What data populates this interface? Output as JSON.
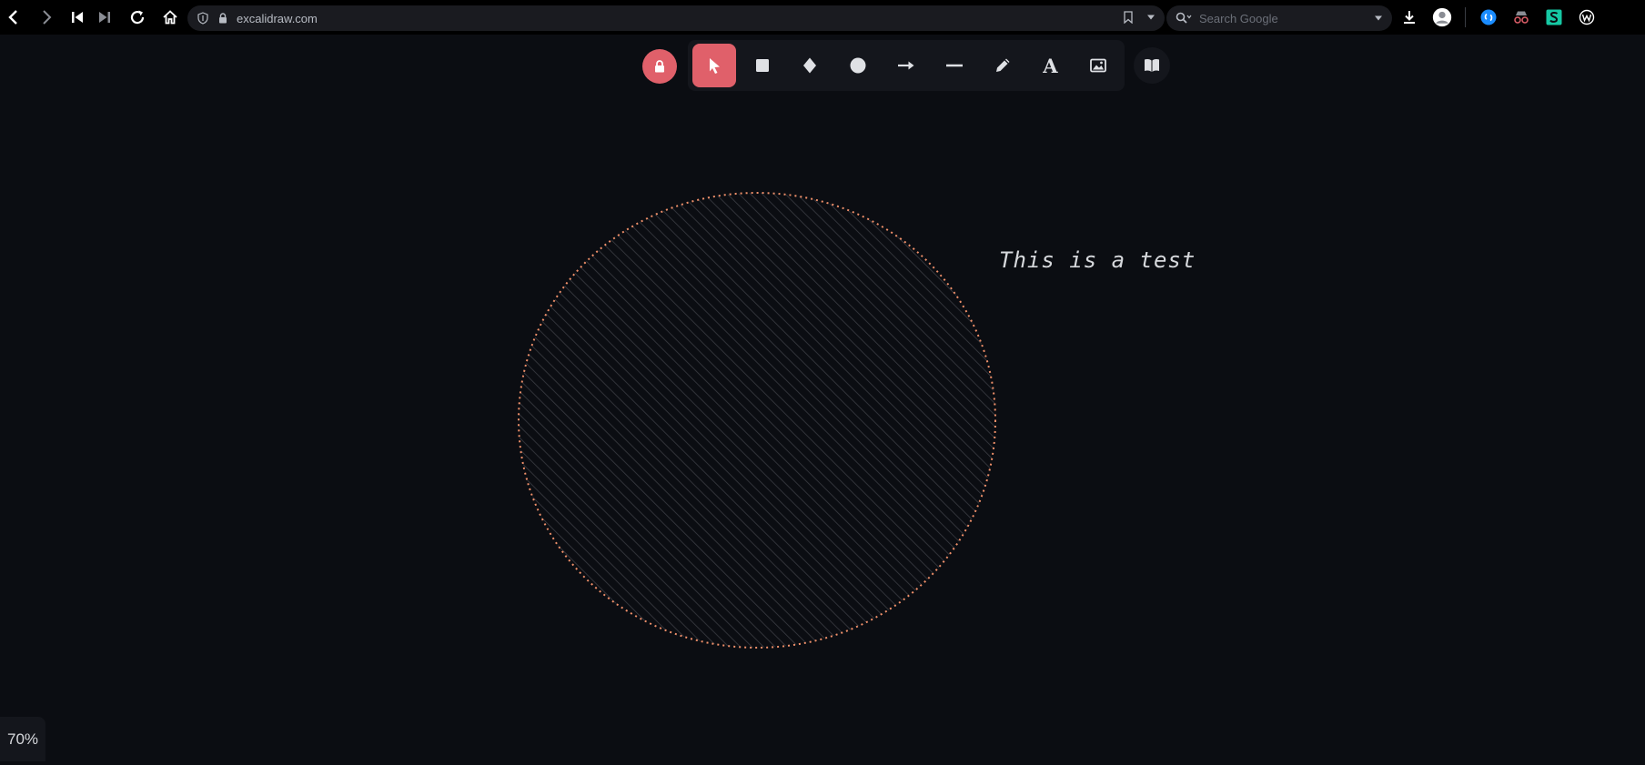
{
  "browser": {
    "url": "excalidraw.com",
    "search_placeholder": "Search Google"
  },
  "toolbar": {
    "tools": [
      {
        "name": "selection",
        "icon": "cursor-icon",
        "active": true
      },
      {
        "name": "rectangle",
        "icon": "square-icon"
      },
      {
        "name": "diamond",
        "icon": "diamond-icon"
      },
      {
        "name": "ellipse",
        "icon": "circle-icon"
      },
      {
        "name": "arrow",
        "icon": "arrow-icon"
      },
      {
        "name": "line",
        "icon": "line-icon"
      },
      {
        "name": "draw",
        "icon": "pencil-icon"
      },
      {
        "name": "text",
        "icon": "text-icon",
        "label": "A"
      },
      {
        "name": "image",
        "icon": "image-icon"
      }
    ]
  },
  "canvas": {
    "text_element": "This is a test",
    "stroke_color": "#f0906a",
    "fill_color": "#3a3c42"
  },
  "zoom": {
    "level": "70%"
  },
  "colors": {
    "accent": "#e0606a",
    "background": "#0b0d12",
    "panel": "#14161c"
  }
}
